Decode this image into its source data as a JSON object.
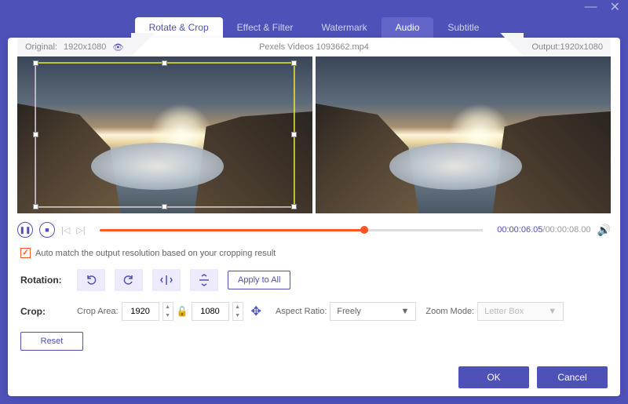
{
  "window": {
    "minimize": "—",
    "close": "✕"
  },
  "tabs": [
    {
      "label": "Rotate & Crop",
      "active": true
    },
    {
      "label": "Effect & Filter"
    },
    {
      "label": "Watermark"
    },
    {
      "label": "Audio",
      "highlight": true
    },
    {
      "label": "Subtitle"
    }
  ],
  "info": {
    "original_label": "Original:",
    "original_res": "1920x1080",
    "filename": "Pexels Videos 1093662.mp4",
    "output_label": "Output:",
    "output_res": "1920x1080"
  },
  "playback": {
    "current": "00:00:06.05",
    "sep": "/",
    "total": "00:00:08.00"
  },
  "automatch": {
    "checked": true,
    "label": "Auto match the output resolution based on your cropping result"
  },
  "rotation": {
    "label": "Rotation:",
    "apply_all": "Apply to All"
  },
  "crop": {
    "label": "Crop:",
    "area_label": "Crop Area:",
    "width": "1920",
    "height": "1080",
    "aspect_label": "Aspect Ratio:",
    "aspect_value": "Freely",
    "zoom_label": "Zoom Mode:",
    "zoom_value": "Letter Box",
    "reset": "Reset"
  },
  "footer": {
    "ok": "OK",
    "cancel": "Cancel"
  }
}
